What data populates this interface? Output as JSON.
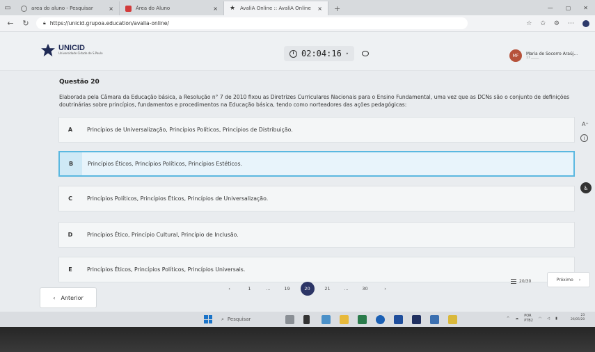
{
  "browser": {
    "tabs": [
      {
        "label": "area do aluno - Pesquisar",
        "close": "×"
      },
      {
        "label": "Área do Aluno",
        "close": "×"
      },
      {
        "label": "AvaliA Online :: AvaliA Online",
        "close": "×"
      }
    ],
    "new_tab": "+",
    "url": "https://unicid.grupoa.education/avalia-online/"
  },
  "header": {
    "logo_text": "UNICID",
    "logo_sub": "Universidade Cidade de S.Paulo",
    "timer": "02:04:16",
    "user_initials": "MF",
    "user_name": "Maria de Socorro Araúj...",
    "user_id": "17 _____"
  },
  "question": {
    "title": "Questão 20",
    "text": "Elaborada pela Câmara da Educação básica, a Resolução n° 7 de 2010 fixou as Diretrizes Curriculares Nacionais para o Ensino Fundamental, uma vez que as DCNs são o conjunto de definições doutrinárias sobre princípios, fundamentos e procedimentos na Educação básica, tendo como norteadores das ações pedagógicas:",
    "options": [
      {
        "letter": "A",
        "text": "Princípios de Universalização, Princípios Políticos, Princípios de Distribuição."
      },
      {
        "letter": "B",
        "text": "Princípios Éticos, Princípios Políticos, Princípios Estéticos."
      },
      {
        "letter": "C",
        "text": "Princípios Políticos, Princípios Éticos, Princípios de Universalização."
      },
      {
        "letter": "D",
        "text": "Princípios Ético, Princípio Cultural, Princípio de Inclusão."
      },
      {
        "letter": "E",
        "text": "Princípios Éticos, Princípios Políticos, Princípios Universais."
      }
    ],
    "selected": "B"
  },
  "side": {
    "font_size": "A⁺"
  },
  "nav": {
    "prev_label": "Anterior",
    "next_label": "Próximo",
    "counter": "20/30",
    "pages": [
      "1",
      "...",
      "19",
      "20",
      "21",
      "...",
      "30"
    ],
    "current_page": "20"
  },
  "taskbar": {
    "search_placeholder": "Pesquisar",
    "lang": "POR",
    "lang2": "PTB2",
    "time": "23",
    "date": "26/05/20"
  },
  "colors": {
    "accent": "#2c3566",
    "selected_border": "#5bb8e0",
    "selected_bg": "#e8f4fb"
  }
}
